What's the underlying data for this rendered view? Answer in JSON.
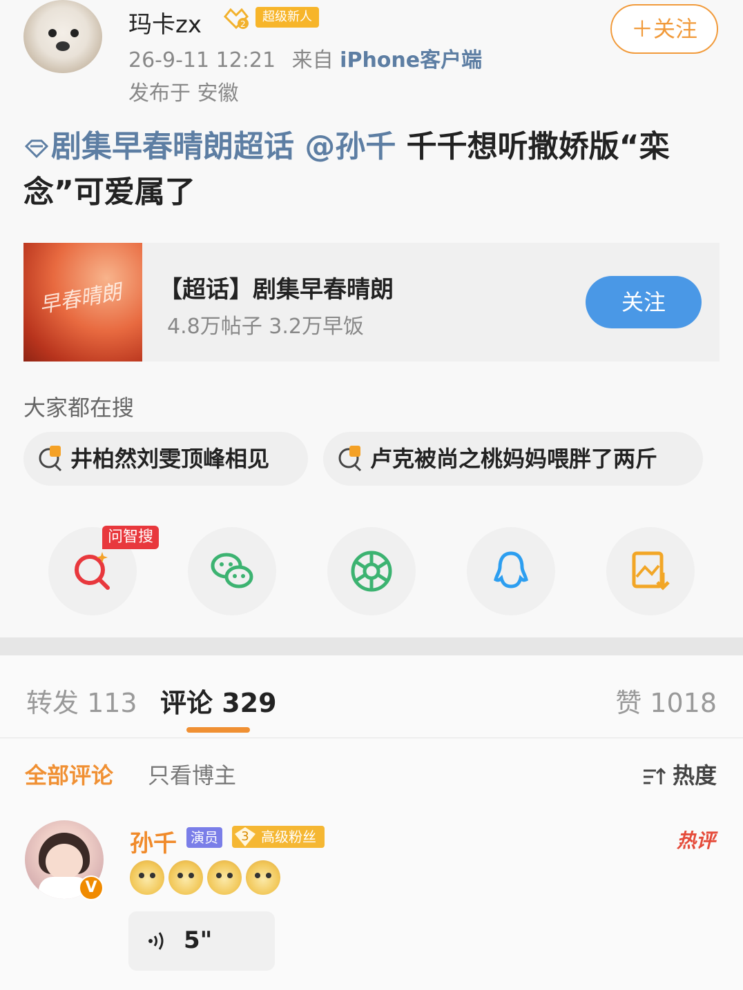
{
  "post": {
    "author": "玛卡zx",
    "level_badge": "超级新人",
    "time": "26-9-11 12:21",
    "source_prefix": "来自",
    "source": "iPhone客户端",
    "location": "发布于 安徽",
    "follow_label": "＋关注",
    "topic_link": "剧集早春晴朗超话",
    "mention": "@孙千",
    "text_rest": " 千千想听撒娇版“栾念”可爱属了"
  },
  "topic_card": {
    "thumb_text": "早春晴朗",
    "title": "【超话】剧集早春晴朗",
    "stats": "4.8万帖子 3.2万早饭",
    "follow_label": "关注"
  },
  "hot_search": {
    "heading": "大家都在搜",
    "items": [
      "井柏然刘雯顶峰相见",
      "卢克被尚之桃妈妈喂胖了两斤"
    ]
  },
  "share": {
    "ai_badge": "问智搜",
    "icons": [
      "ai-search-icon",
      "wechat-icon",
      "moments-icon",
      "qq-icon",
      "save-image-icon"
    ]
  },
  "tabs": {
    "forward": "转发 113",
    "comment": "评论 329",
    "like": "赞 1018"
  },
  "sub_tabs": {
    "all": "全部评论",
    "owner_only": "只看博主",
    "sort": "热度"
  },
  "comment": {
    "name": "孙千",
    "role_badge": "演员",
    "fan_level": "3",
    "fan_badge": "高级粉丝",
    "hot_tag": "热评",
    "verified": "V",
    "voice_duration": "5\""
  },
  "colors": {
    "accent_orange": "#f09033",
    "link_blue": "#5d7ea3",
    "follow_blue": "#4a98e6",
    "badge_gold": "#f5b733"
  }
}
